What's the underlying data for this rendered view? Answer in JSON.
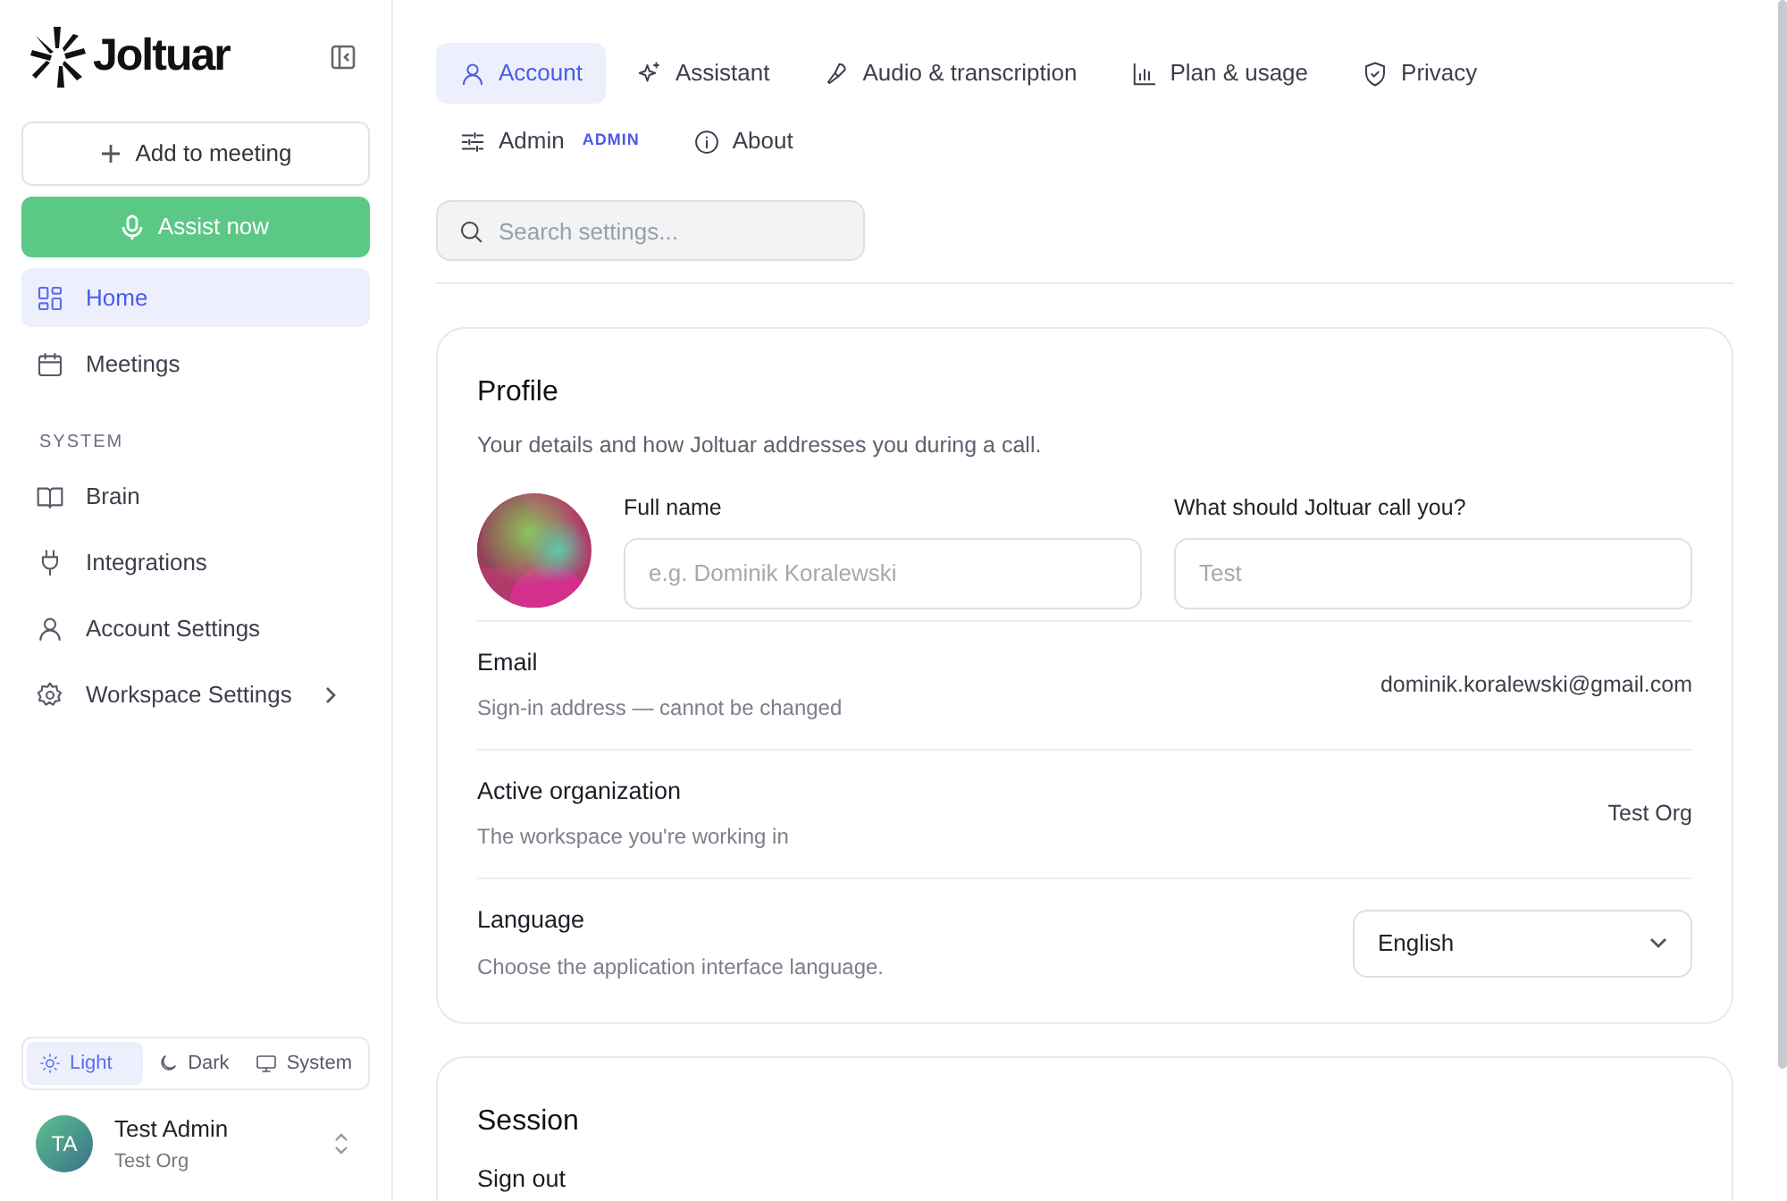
{
  "sidebar": {
    "brand": "Joltuar",
    "actions": [
      {
        "kind": "outline",
        "label": "Add to meeting"
      },
      {
        "kind": "primary",
        "label": "Assist now"
      }
    ],
    "nav": [
      {
        "label": "Home",
        "selected": true
      },
      {
        "label": "Meetings",
        "selected": false
      }
    ],
    "section_label": "SYSTEM",
    "system_nav": [
      {
        "label": "Brain",
        "selected": false,
        "submenu": false
      },
      {
        "label": "Integrations",
        "selected": false,
        "submenu": false
      },
      {
        "label": "Account Settings",
        "selected": false,
        "submenu": false
      },
      {
        "label": "Workspace Settings",
        "selected": false,
        "submenu": true
      }
    ],
    "theme": [
      {
        "label": "Light",
        "selected": true
      },
      {
        "label": "Dark",
        "selected": false
      },
      {
        "label": "System",
        "selected": false
      }
    ],
    "user": {
      "initials": "TA",
      "name": "Test Admin",
      "org": "Test Org"
    }
  },
  "tabs": [
    {
      "label": "Account",
      "selected": true
    },
    {
      "label": "Assistant",
      "selected": false
    },
    {
      "label": "Audio & transcription",
      "selected": false
    },
    {
      "label": "Plan & usage",
      "selected": false
    },
    {
      "label": "Privacy",
      "selected": false
    },
    {
      "label": "Admin",
      "selected": false,
      "badge": "ADMIN"
    },
    {
      "label": "About",
      "selected": false
    }
  ],
  "search": {
    "placeholder": "Search settings..."
  },
  "profile": {
    "title": "Profile",
    "description": "Your details and how Joltuar addresses you during a call.",
    "fields": [
      {
        "label": "Full name",
        "placeholder": "e.g. Dominik Koralewski"
      },
      {
        "label": "What should Joltuar call you?",
        "placeholder": "Test"
      }
    ],
    "rows": [
      {
        "kind": "text",
        "label": "Email",
        "hint": "Sign-in address — cannot be changed",
        "value": "dominik.koralewski@gmail.com"
      },
      {
        "kind": "text",
        "label": "Active organization",
        "hint": "The workspace you're working in",
        "value": "Test Org"
      },
      {
        "kind": "select",
        "label": "Language",
        "hint": "Choose the application interface language.",
        "value": "English"
      }
    ]
  },
  "session": {
    "title": "Session",
    "rows": [
      {
        "label": "Sign out"
      }
    ]
  }
}
